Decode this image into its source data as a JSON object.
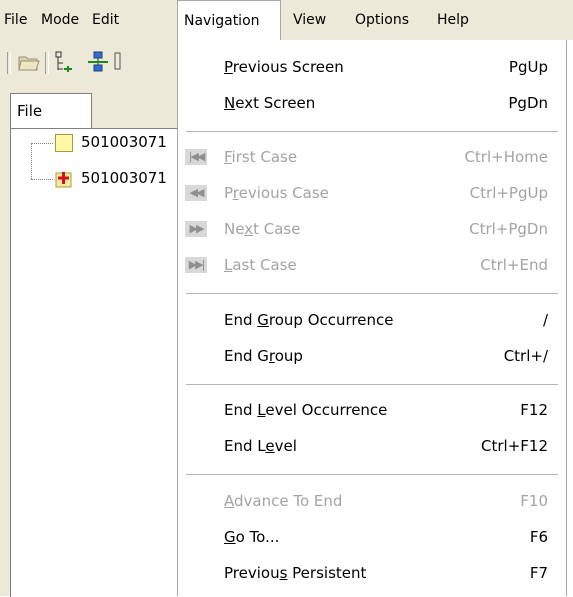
{
  "menubar": {
    "items": [
      {
        "label": "File"
      },
      {
        "label": "Mode"
      },
      {
        "label": "Edit"
      },
      {
        "label": "Navigation",
        "active": true
      },
      {
        "label": "View"
      },
      {
        "label": "Options"
      },
      {
        "label": "Help"
      }
    ]
  },
  "toolbar": {
    "icons": [
      "open-folder-icon",
      "tree-collapse-icon",
      "tree-expand-icon",
      "tree-icon"
    ]
  },
  "left_pane": {
    "tab_label": "File",
    "tree": [
      {
        "label": "501003071",
        "icon": "yellow-square-icon"
      },
      {
        "label": "501003071",
        "icon": "red-plus-icon"
      }
    ]
  },
  "navigation_menu": {
    "groups": [
      [
        {
          "label": "Previous Screen",
          "mnemonic": "P",
          "shortcut": "PgUp",
          "enabled": true
        },
        {
          "label": "Next Screen",
          "mnemonic": "N",
          "shortcut": "PgDn",
          "enabled": true
        }
      ],
      [
        {
          "label": "First Case",
          "mnemonic": "F",
          "shortcut": "Ctrl+Home",
          "enabled": false,
          "icon": "first-icon",
          "glyph": "|◀◀"
        },
        {
          "label": "Previous Case",
          "mnemonic": "r",
          "shortcut": "Ctrl+PgUp",
          "enabled": false,
          "icon": "previous-icon",
          "glyph": "◀◀"
        },
        {
          "label": "Next Case",
          "mnemonic": "x",
          "shortcut": "Ctrl+PgDn",
          "enabled": false,
          "icon": "next-icon",
          "glyph": "▶▶"
        },
        {
          "label": "Last Case",
          "mnemonic": "L",
          "shortcut": "Ctrl+End",
          "enabled": false,
          "icon": "last-icon",
          "glyph": "▶▶|"
        }
      ],
      [
        {
          "label": "End Group Occurrence",
          "mnemonic": "G",
          "shortcut": "/",
          "enabled": true
        },
        {
          "label": "End Group",
          "mnemonic": "r",
          "shortcut": "Ctrl+/",
          "enabled": true
        }
      ],
      [
        {
          "label": "End Level Occurrence",
          "mnemonic": "L",
          "shortcut": "F12",
          "enabled": true
        },
        {
          "label": "End Level",
          "mnemonic": "e",
          "shortcut": "Ctrl+F12",
          "enabled": true
        }
      ],
      [
        {
          "label": "Advance To End",
          "mnemonic": "A",
          "shortcut": "F10",
          "enabled": false
        },
        {
          "label": "Go To...",
          "mnemonic": "G",
          "shortcut": "F6",
          "enabled": true
        },
        {
          "label": "Previous Persistent",
          "mnemonic": "s",
          "shortcut": "F7",
          "enabled": true
        }
      ]
    ]
  },
  "colors": {
    "menubar_bg": "#ece9d8",
    "disabled_text": "#a3a3a3",
    "separator": "#b5b5b5"
  }
}
